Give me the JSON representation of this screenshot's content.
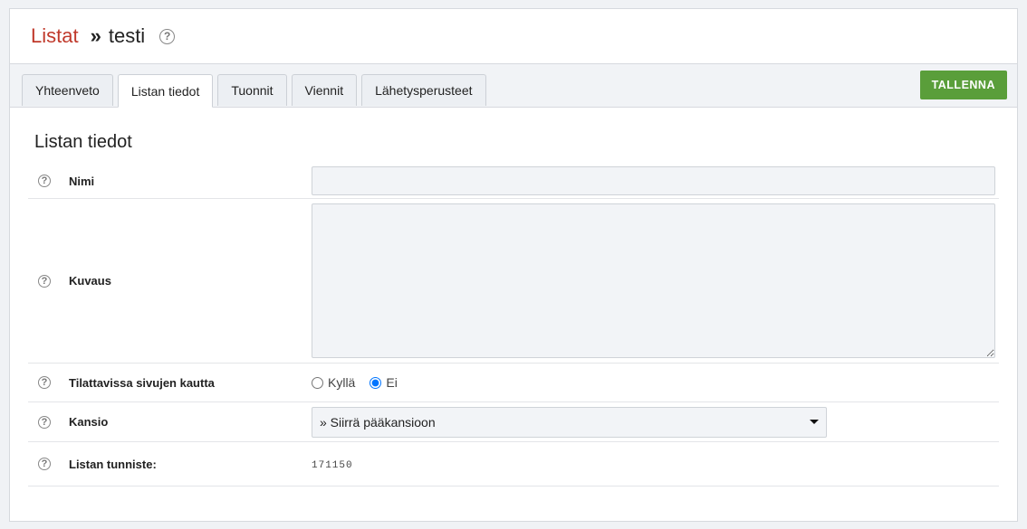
{
  "breadcrumb": {
    "parent": "Listat",
    "separator": "»",
    "current": "testi"
  },
  "help_glyph": "?",
  "tabs": [
    {
      "label": "Yhteenveto",
      "active": false
    },
    {
      "label": "Listan tiedot",
      "active": true
    },
    {
      "label": "Tuonnit",
      "active": false
    },
    {
      "label": "Viennit",
      "active": false
    },
    {
      "label": "Lähetysperusteet",
      "active": false
    }
  ],
  "toolbar": {
    "save_label": "TALLENNA"
  },
  "section": {
    "title": "Listan tiedot"
  },
  "form": {
    "name": {
      "label": "Nimi",
      "value": ""
    },
    "description": {
      "label": "Kuvaus",
      "value": ""
    },
    "subscribable": {
      "label": "Tilattavissa sivujen kautta",
      "options": [
        {
          "label": "Kyllä",
          "checked": false
        },
        {
          "label": "Ei",
          "checked": true
        }
      ]
    },
    "folder": {
      "label": "Kansio",
      "selected": "» Siirrä pääkansioon"
    },
    "list_id": {
      "label": "Listan tunniste:",
      "value": "171150"
    }
  },
  "colors": {
    "breadcrumb_link": "#c0392b",
    "save_button": "#5a9e3a"
  },
  "icons": {
    "help": "help-icon",
    "dropdown": "caret-down-icon"
  }
}
